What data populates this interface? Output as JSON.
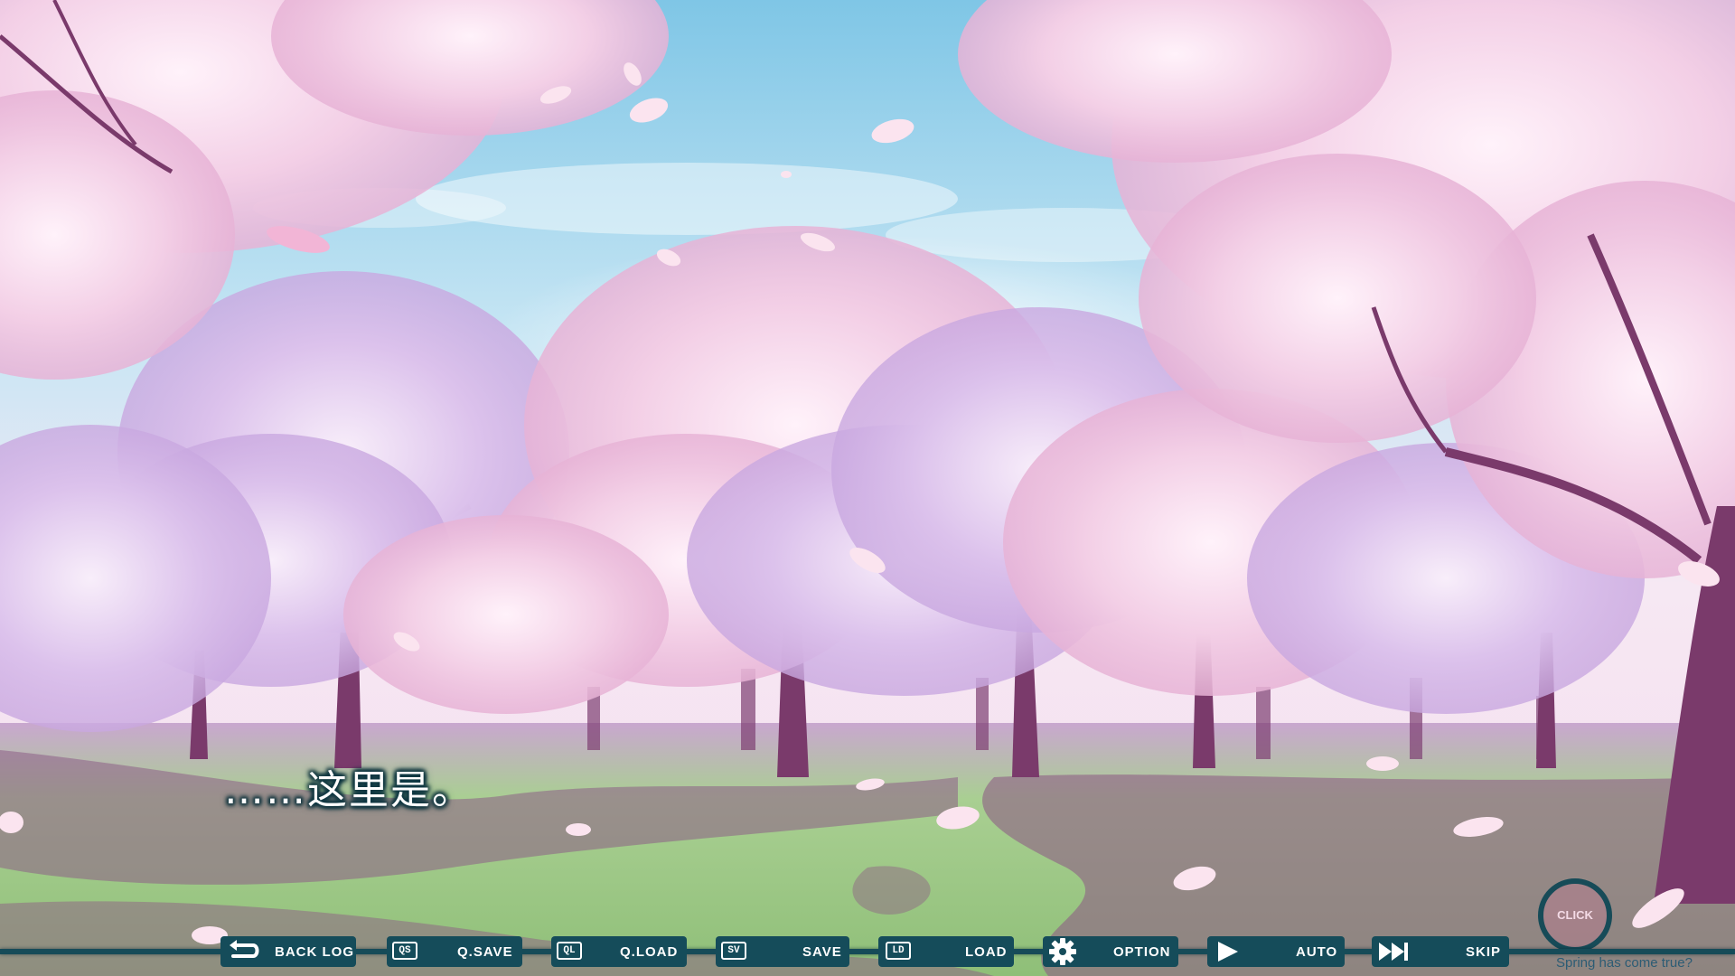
{
  "dialogue": {
    "text": "……这里是。"
  },
  "controls": [
    {
      "label": "BACK LOG",
      "icon": "back-arrow-icon",
      "key": ""
    },
    {
      "label": "Q.SAVE",
      "icon": "quick-save-key-icon",
      "key": "QS"
    },
    {
      "label": "Q.LOAD",
      "icon": "quick-load-key-icon",
      "key": "QL"
    },
    {
      "label": "SAVE",
      "icon": "save-key-icon",
      "key": "SV"
    },
    {
      "label": "LOAD",
      "icon": "load-key-icon",
      "key": "LD"
    },
    {
      "label": "OPTION",
      "icon": "gear-icon",
      "key": ""
    },
    {
      "label": "AUTO",
      "icon": "play-icon",
      "key": ""
    },
    {
      "label": "SKIP",
      "icon": "fast-forward-icon",
      "key": ""
    }
  ],
  "click_indicator": {
    "label": "CLICK"
  },
  "tagline": "Spring has come true?",
  "colors": {
    "bar": "#154c5a",
    "sky_top": "#8fcde8",
    "blossom": "#f2c6df",
    "grass": "#9ccc7c",
    "shadow": "#8d5d86"
  }
}
